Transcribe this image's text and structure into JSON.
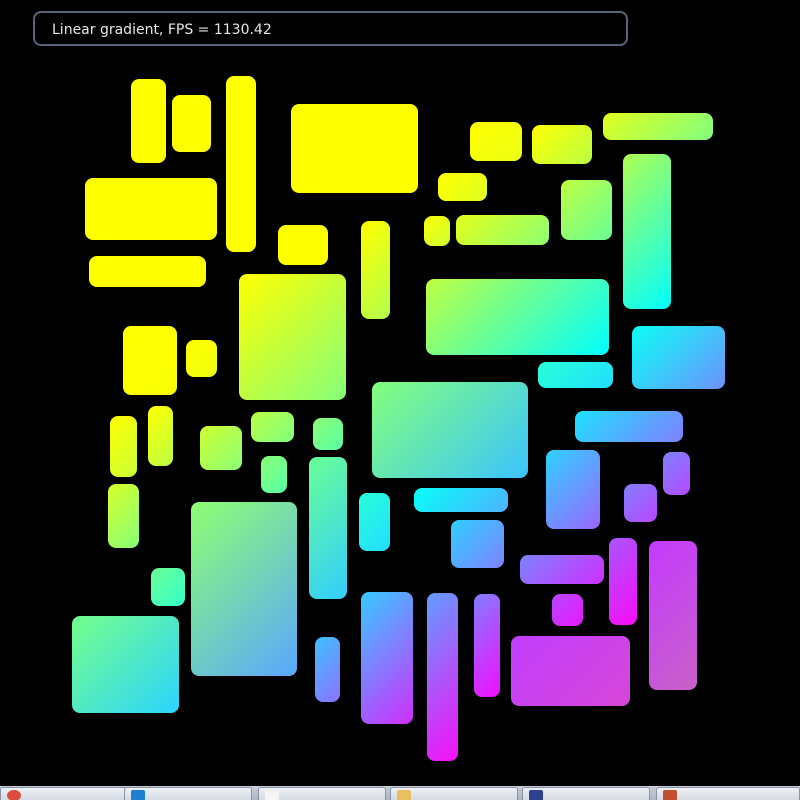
{
  "status": {
    "text": "Linear gradient, FPS = 1130.42"
  },
  "gradient": {
    "stops": [
      "#ffff00",
      "#00ffff",
      "#ff00ff",
      "#80e080"
    ]
  },
  "taskbar": {
    "items": [
      {
        "icon": "chrome-icon",
        "color": "#dc4b3c"
      },
      {
        "icon": "vscode-icon",
        "color": "#1f7fd4"
      },
      {
        "icon": "cat-app-icon",
        "color": "#f4f4f4"
      },
      {
        "icon": "folder-icon",
        "color": "#e8c060"
      },
      {
        "icon": "document-icon",
        "color": "#304090"
      },
      {
        "icon": "paint-icon",
        "color": "#c05030"
      }
    ]
  }
}
